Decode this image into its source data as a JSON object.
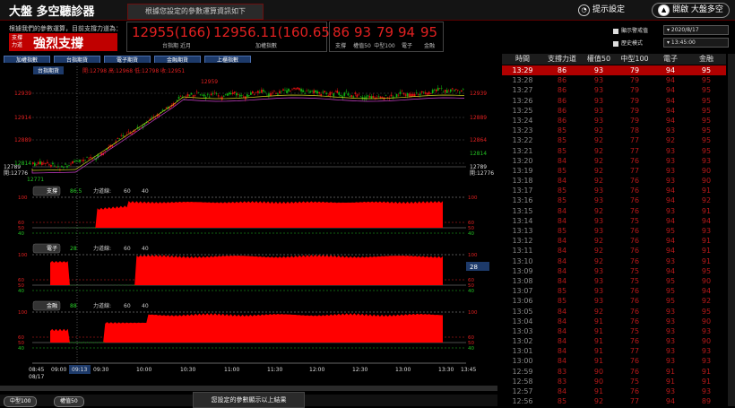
{
  "app": {
    "brand": "大盤 多空聽診器",
    "mode_tab": "根據您設定的參數運算資訊如下",
    "hint_label": "提示設定",
    "open_label": "開啟 大盤多空"
  },
  "summary": {
    "info": "根據我們的參數運算，目前支撐力道為：",
    "status_small_1": "支撐",
    "status_small_2": "力道",
    "status_text": "強烈支撐",
    "box1": {
      "value": "12955(166)",
      "label": "台指期 近月"
    },
    "box2": {
      "value": "12956.11(160.65)",
      "label": "加權指數"
    },
    "box3": {
      "values": [
        "86",
        "93",
        "79",
        "94",
        "95"
      ],
      "labels": [
        "支撐",
        "權值50",
        "中型100",
        "電子",
        "金融"
      ]
    }
  },
  "options": {
    "opt1": "顯示警戒值",
    "opt2": "歷史模式",
    "date": "2020/8/17",
    "time": "13:45:00"
  },
  "buttons": [
    "加權指數",
    "台指期貨",
    "電子期貨",
    "金融期貨",
    "上櫃指數"
  ],
  "chart_header": {
    "tab": "台指期貨",
    "quote": "開:12798  高:12968  低:12798  收:12951"
  },
  "panels": [
    {
      "name": "支撐",
      "value": "86.5",
      "strength_label": "力道線:",
      "opt1": "60",
      "opt2": "40"
    },
    {
      "name": "電子",
      "value": "28",
      "strength_label": "力道線:",
      "opt1": "60",
      "opt2": "40"
    },
    {
      "name": "金融",
      "value": "88",
      "strength_label": "力道線:",
      "opt1": "60",
      "opt2": "40"
    }
  ],
  "price_labels": {
    "high": "12959",
    "low_left": "12789",
    "open_left": "開:12776",
    "low_sub": "12771",
    "left_ticks": [
      "12939",
      "12914",
      "12889",
      "12864",
      "12839",
      "12814"
    ],
    "right_ticks": [
      "12939",
      "12889",
      "12864",
      "12839",
      "12814",
      "12789",
      "開:12776"
    ],
    "panel_ticks_left": [
      "100",
      "60",
      "50",
      "40"
    ],
    "panel_ticks_right": [
      "100",
      "60",
      "50",
      "40"
    ],
    "side_badge": "28"
  },
  "x_axis": {
    "ticks": [
      "08:45",
      "09:00",
      "09:13",
      "09:30",
      "10:00",
      "10:30",
      "11:00",
      "11:30",
      "12:00",
      "12:30",
      "13:00",
      "13:30",
      "13:45"
    ],
    "date": "08/17"
  },
  "table": {
    "headers": [
      "時間",
      "支撐力道",
      "權值50",
      "中型100",
      "電子",
      "金融"
    ],
    "rows": [
      [
        "13:29",
        "86",
        "93",
        "79",
        "94",
        "95"
      ],
      [
        "13:28",
        "86",
        "93",
        "79",
        "94",
        "95"
      ],
      [
        "13:27",
        "86",
        "93",
        "79",
        "94",
        "95"
      ],
      [
        "13:26",
        "86",
        "93",
        "79",
        "94",
        "95"
      ],
      [
        "13:25",
        "86",
        "93",
        "79",
        "94",
        "95"
      ],
      [
        "13:24",
        "86",
        "93",
        "79",
        "94",
        "95"
      ],
      [
        "13:23",
        "85",
        "92",
        "78",
        "93",
        "95"
      ],
      [
        "13:22",
        "85",
        "92",
        "77",
        "92",
        "95"
      ],
      [
        "13:21",
        "85",
        "92",
        "77",
        "93",
        "95"
      ],
      [
        "13:20",
        "84",
        "92",
        "76",
        "93",
        "93"
      ],
      [
        "13:19",
        "85",
        "92",
        "77",
        "93",
        "90"
      ],
      [
        "13:18",
        "84",
        "92",
        "76",
        "93",
        "90"
      ],
      [
        "13:17",
        "85",
        "93",
        "76",
        "94",
        "91"
      ],
      [
        "13:16",
        "85",
        "93",
        "76",
        "94",
        "92"
      ],
      [
        "13:15",
        "84",
        "92",
        "76",
        "93",
        "91"
      ],
      [
        "13:14",
        "84",
        "93",
        "75",
        "94",
        "94"
      ],
      [
        "13:13",
        "85",
        "93",
        "76",
        "95",
        "93"
      ],
      [
        "13:12",
        "84",
        "92",
        "76",
        "94",
        "91"
      ],
      [
        "13:11",
        "84",
        "92",
        "76",
        "94",
        "91"
      ],
      [
        "13:10",
        "84",
        "92",
        "76",
        "93",
        "91"
      ],
      [
        "13:09",
        "84",
        "93",
        "75",
        "94",
        "95"
      ],
      [
        "13:08",
        "84",
        "93",
        "75",
        "95",
        "90"
      ],
      [
        "13:07",
        "85",
        "93",
        "76",
        "95",
        "94"
      ],
      [
        "13:06",
        "85",
        "93",
        "76",
        "95",
        "92"
      ],
      [
        "13:05",
        "84",
        "92",
        "76",
        "93",
        "95"
      ],
      [
        "13:04",
        "84",
        "91",
        "76",
        "93",
        "90"
      ],
      [
        "13:03",
        "84",
        "91",
        "75",
        "93",
        "93"
      ],
      [
        "13:02",
        "84",
        "91",
        "76",
        "93",
        "90"
      ],
      [
        "13:01",
        "84",
        "91",
        "77",
        "93",
        "93"
      ],
      [
        "13:00",
        "84",
        "91",
        "76",
        "93",
        "93"
      ],
      [
        "12:59",
        "83",
        "90",
        "76",
        "91",
        "91"
      ],
      [
        "12:58",
        "83",
        "90",
        "75",
        "91",
        "91"
      ],
      [
        "12:57",
        "84",
        "91",
        "76",
        "93",
        "93"
      ],
      [
        "12:56",
        "85",
        "92",
        "77",
        "94",
        "89"
      ],
      [
        "12:55",
        "84",
        "92",
        "76",
        "93",
        "93"
      ]
    ]
  },
  "status": {
    "chip1": "中型100",
    "chip2": "權值50",
    "toast": "您設定的參數顯示以上結果"
  },
  "colors": {
    "accent_red": "#e02020",
    "fill_red": "#ff0000",
    "fill_green": "#0a7a0a",
    "candle_up": "#e01010",
    "candle_down": "#10b010",
    "brand_bg": "#141414"
  }
}
